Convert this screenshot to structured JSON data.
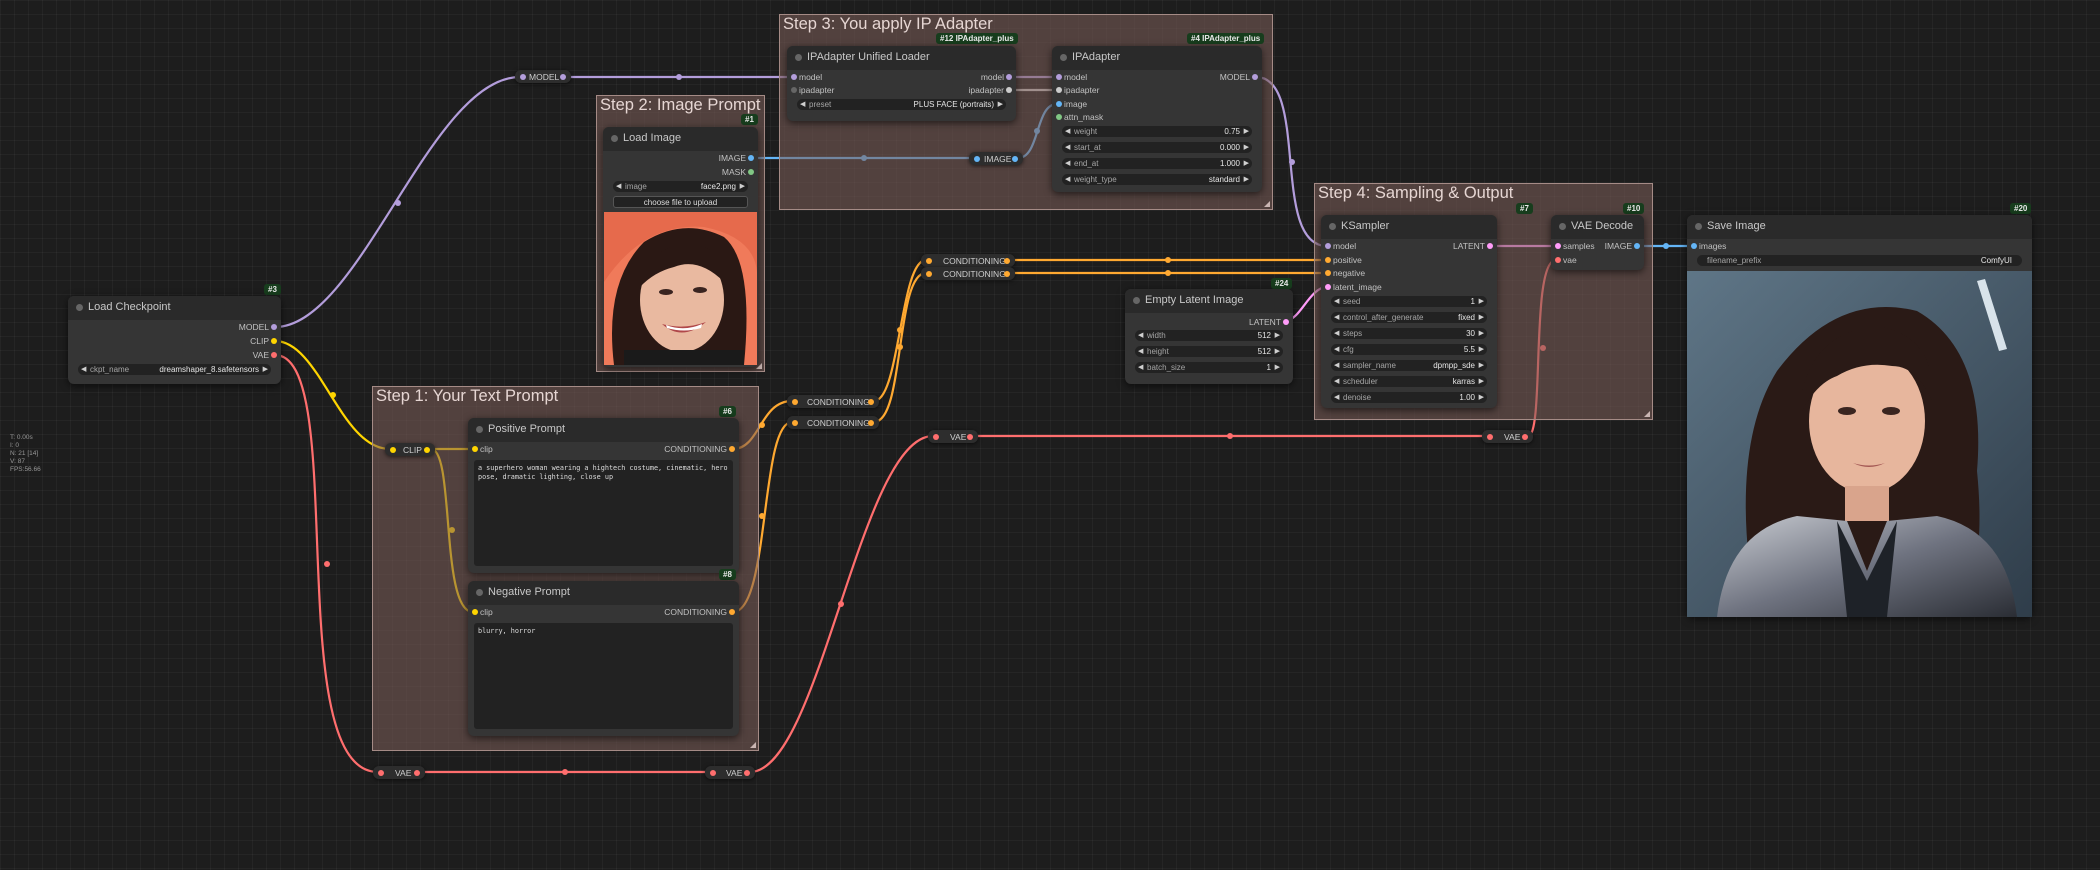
{
  "colors": {
    "model": "#b39ddb",
    "clip": "#ffd500",
    "vae": "#ff6e6e",
    "conditioning": "#ffa931",
    "image": "#64b5f6",
    "latent": "#ff9cf9",
    "mask": "#81c784",
    "ipadapter": "#cccccc",
    "badge": "#173d1d"
  },
  "groups": {
    "step1": "Step 1: Your Text Prompt",
    "step2": "Step 2: Image Prompt",
    "step3": "Step 3: You apply IP Adapter",
    "step4": "Step 4: Sampling & Output"
  },
  "nodes": {
    "load_checkpoint": {
      "title": "Load Checkpoint",
      "badge": "#3",
      "outputs": [
        "MODEL",
        "CLIP",
        "VAE"
      ],
      "widget": {
        "name": "ckpt_name",
        "value": "dreamshaper_8.safetensors"
      }
    },
    "load_image": {
      "title": "Load Image",
      "badge": "#1",
      "outputs": [
        "IMAGE",
        "MASK"
      ],
      "widget": {
        "name": "image",
        "value": "face2.png"
      },
      "upload_label": "choose file to upload"
    },
    "ipa_loader": {
      "title": "IPAdapter Unified Loader",
      "badge": "#12 IPAdapter_plus",
      "inputs": [
        "model",
        "ipadapter"
      ],
      "outputs": [
        "model",
        "ipadapter"
      ],
      "widget": {
        "name": "preset",
        "value": "PLUS FACE (portraits)"
      }
    },
    "ipadapter": {
      "title": "IPAdapter",
      "badge": "#4 IPAdapter_plus",
      "inputs": [
        "model",
        "ipadapter",
        "image",
        "attn_mask"
      ],
      "outputs": [
        "MODEL"
      ],
      "widgets": [
        {
          "name": "weight",
          "value": "0.75"
        },
        {
          "name": "start_at",
          "value": "0.000"
        },
        {
          "name": "end_at",
          "value": "1.000"
        },
        {
          "name": "weight_type",
          "value": "standard"
        }
      ]
    },
    "positive": {
      "title": "Positive Prompt",
      "badge": "#6",
      "input": "clip",
      "output": "CONDITIONING",
      "text": "a superhero woman wearing a hightech costume, cinematic, hero pose, dramatic lighting, close up"
    },
    "negative": {
      "title": "Negative Prompt",
      "badge": "#8",
      "input": "clip",
      "output": "CONDITIONING",
      "text": "blurry, horror"
    },
    "empty_latent": {
      "title": "Empty Latent Image",
      "badge": "#24",
      "output": "LATENT",
      "widgets": [
        {
          "name": "width",
          "value": "512"
        },
        {
          "name": "height",
          "value": "512"
        },
        {
          "name": "batch_size",
          "value": "1"
        }
      ]
    },
    "ksampler": {
      "title": "KSampler",
      "badge": "#7",
      "inputs": [
        "model",
        "positive",
        "negative",
        "latent_image"
      ],
      "output": "LATENT",
      "widgets": [
        {
          "name": "seed",
          "value": "1"
        },
        {
          "name": "control_after_generate",
          "value": "fixed"
        },
        {
          "name": "steps",
          "value": "30"
        },
        {
          "name": "cfg",
          "value": "5.5"
        },
        {
          "name": "sampler_name",
          "value": "dpmpp_sde"
        },
        {
          "name": "scheduler",
          "value": "karras"
        },
        {
          "name": "denoise",
          "value": "1.00"
        }
      ]
    },
    "vae_decode": {
      "title": "VAE Decode",
      "badge": "#10",
      "inputs": [
        "samples",
        "vae"
      ],
      "output": "IMAGE"
    },
    "save_image": {
      "title": "Save Image",
      "badge": "#20",
      "input": "images",
      "widget": {
        "name": "filename_prefix",
        "value": "ComfyUI"
      }
    }
  },
  "reroutes": {
    "model": "MODEL",
    "clip": "CLIP",
    "image": "IMAGE",
    "cond1": "CONDITIONING",
    "cond2": "CONDITIONING",
    "cond3": "CONDITIONING",
    "cond4": "CONDITIONING",
    "vae_bottom_left": "VAE",
    "vae_bottom_right": "VAE",
    "vae_mid_left": "VAE",
    "vae_mid_right": "VAE"
  },
  "stats": [
    "T: 0.00s",
    "I: 0",
    "N: 21 [14]",
    "V: 87",
    "FPS:56.66"
  ]
}
